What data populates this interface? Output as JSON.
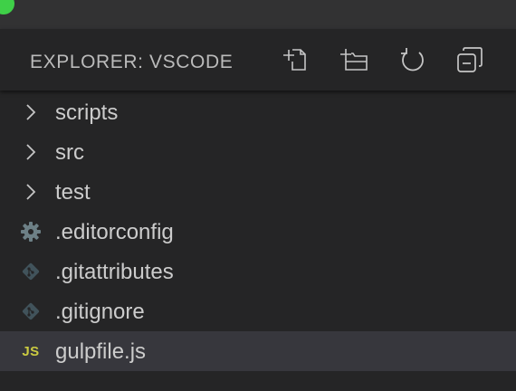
{
  "window": {
    "traffic_light_color": "#3fd048"
  },
  "explorer": {
    "title": "EXPLORER: VSCODE",
    "actions": [
      {
        "icon": "new-file-icon"
      },
      {
        "icon": "new-folder-icon"
      },
      {
        "icon": "refresh-icon"
      },
      {
        "icon": "collapse-all-icon"
      }
    ],
    "items": [
      {
        "label": "scripts",
        "kind": "folder",
        "icon": "chevron-right-icon"
      },
      {
        "label": "src",
        "kind": "folder",
        "icon": "chevron-right-icon"
      },
      {
        "label": "test",
        "kind": "folder",
        "icon": "chevron-right-icon"
      },
      {
        "label": ".editorconfig",
        "kind": "file",
        "icon": "gear-icon"
      },
      {
        "label": ".gitattributes",
        "kind": "file",
        "icon": "git-icon"
      },
      {
        "label": ".gitignore",
        "kind": "file",
        "icon": "git-icon"
      },
      {
        "label": "gulpfile.js",
        "kind": "file",
        "icon": "js-icon",
        "icon_text": "JS",
        "selected": true
      }
    ]
  },
  "colors": {
    "background": "#252526",
    "titlebar": "#323233",
    "selected_row": "#37373d",
    "text": "#cccccc",
    "header_text": "#bbbbbb",
    "js_icon": "#cbcb41",
    "git_icon": "#41535b",
    "gear_icon": "#6d8086"
  }
}
